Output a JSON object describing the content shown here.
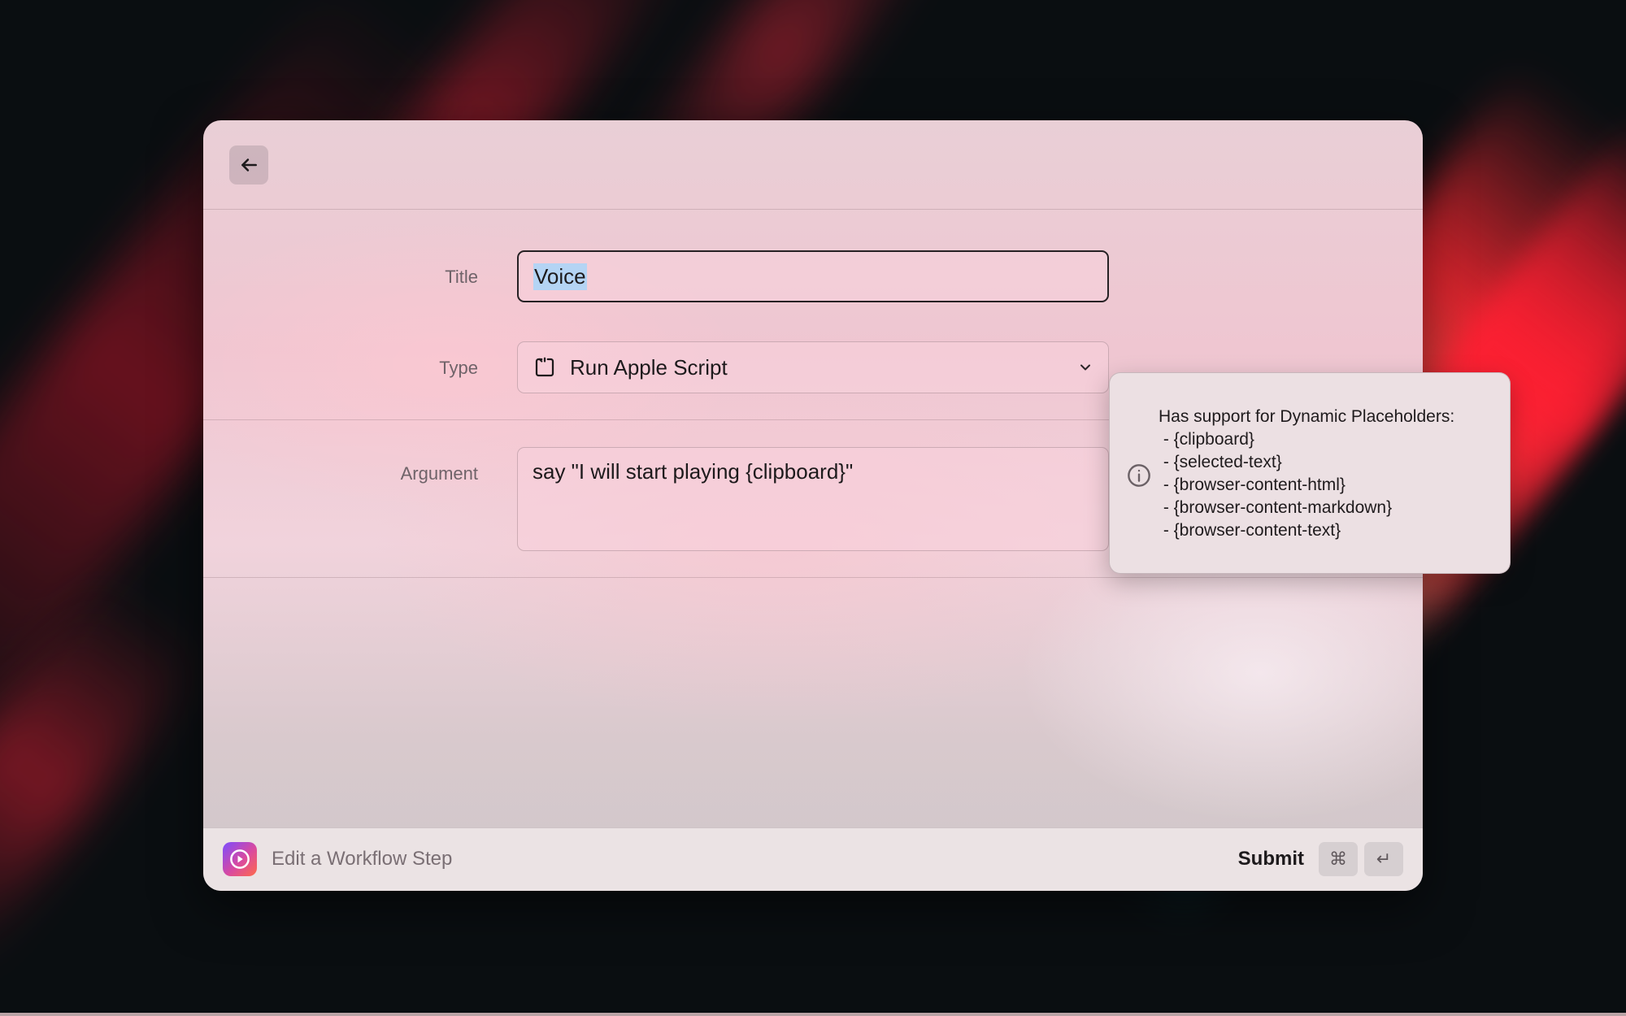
{
  "window": {
    "back_icon": "arrow-left-icon"
  },
  "form": {
    "title": {
      "label": "Title",
      "value": "Voice"
    },
    "type": {
      "label": "Type",
      "value": "Run Apple Script",
      "icon": "script-icon",
      "dropdown_icon": "chevron-down-icon"
    },
    "argument": {
      "label": "Argument",
      "value": "say \"I will start playing {clipboard}\""
    }
  },
  "tooltip": {
    "icon": "info-icon",
    "heading": "Has support for Dynamic Placeholders:",
    "items": [
      " - {clipboard}",
      " - {selected-text}",
      " - {browser-content-html}",
      " - {browser-content-markdown}",
      " - {browser-content-text}"
    ]
  },
  "footer": {
    "app_icon": "raycast-app-icon",
    "title": "Edit a Workflow Step",
    "submit_label": "Submit",
    "shortcut_keys": [
      "⌘",
      "↵"
    ]
  },
  "colors": {
    "selection": "#b4d4f4",
    "app_icon_gradient": [
      "#7c4dff",
      "#d94aa0",
      "#ff6a4a"
    ]
  }
}
